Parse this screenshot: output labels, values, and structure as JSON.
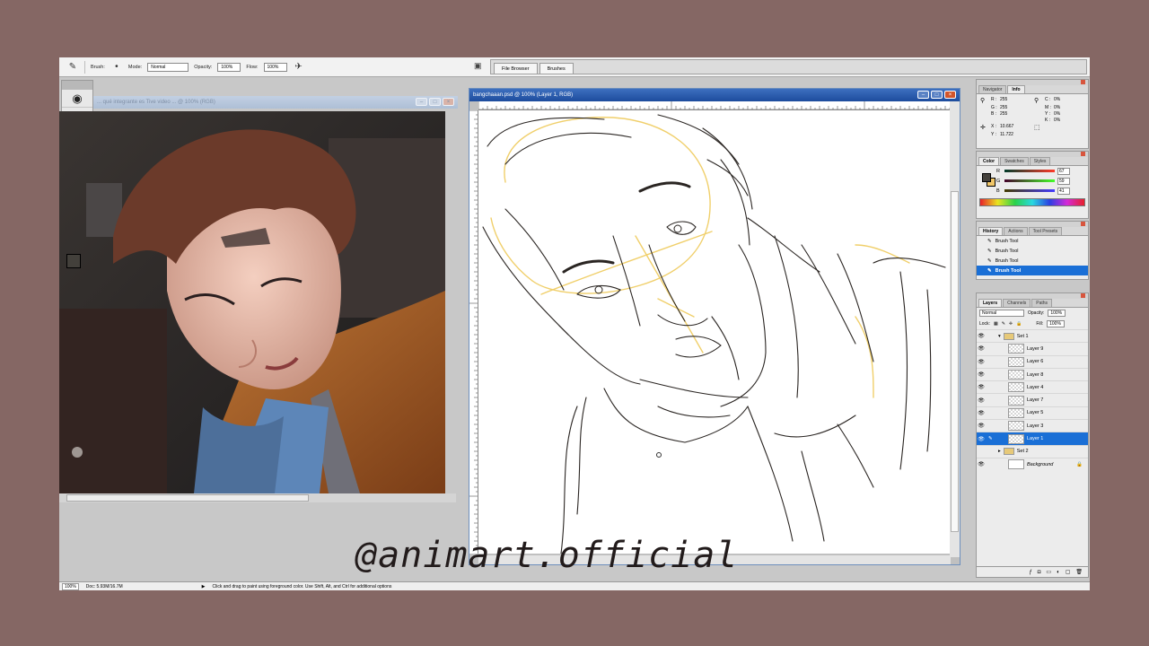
{
  "options_bar": {
    "brush_label": "Brush:",
    "mode_label": "Mode:",
    "mode_value": "Normal",
    "opacity_label": "Opacity:",
    "opacity_value": "100%",
    "flow_label": "Flow:",
    "flow_value": "100%"
  },
  "palette_well": {
    "tabs": [
      "File Browser",
      "Brushes"
    ]
  },
  "reference_window": {
    "title": "... qué integrante es Tive video ... @ 100% (RGB)"
  },
  "sketch_window": {
    "title": "bangchaaan.psd @ 100% (Layer 1, RGB)"
  },
  "navigator": {
    "tabs": [
      "Navigator",
      "Info"
    ],
    "rgb_labels": [
      "R :",
      "G :",
      "B :"
    ],
    "rgb_values": [
      "255",
      "255",
      "255"
    ],
    "cmyk_labels": [
      "C :",
      "M :",
      "Y :",
      "K :"
    ],
    "cmyk_values": [
      "0%",
      "0%",
      "0%",
      "0%"
    ],
    "x_label": "X :",
    "x_value": "10.667",
    "y_label": "Y :",
    "y_value": "11.722"
  },
  "color_palette": {
    "tabs": [
      "Color",
      "Swatches",
      "Styles"
    ],
    "channels": [
      {
        "name": "R",
        "value": "67"
      },
      {
        "name": "G",
        "value": "59"
      },
      {
        "name": "B",
        "value": "41"
      }
    ],
    "foreground": "#43403b",
    "background": "#f1c769"
  },
  "history_palette": {
    "tabs": [
      "History",
      "Actions",
      "Tool Presets"
    ],
    "items": [
      "Brush Tool",
      "Brush Tool",
      "Brush Tool",
      "Brush Tool"
    ]
  },
  "layers_palette": {
    "tabs": [
      "Layers",
      "Channels",
      "Paths"
    ],
    "blend_mode": "Normal",
    "opacity_label": "Opacity:",
    "opacity_value": "100%",
    "lock_label": "Lock:",
    "fill_label": "Fill:",
    "fill_value": "100%",
    "layers": [
      "Set 1",
      "Layer 9",
      "Layer 6",
      "Layer 8",
      "Layer 4",
      "Layer 7",
      "Layer 5",
      "Layer 3",
      "Layer 1",
      "Set 2",
      "Background"
    ],
    "active_layer": "Layer 1"
  },
  "status_bar": {
    "zoom": "100%",
    "doc_size": "Doc: 5.93M/16.7M",
    "hint": "Click and drag to paint using foreground color. Use Shift, Alt, and Ctrl for additional options"
  },
  "watermark": "@animart.official"
}
